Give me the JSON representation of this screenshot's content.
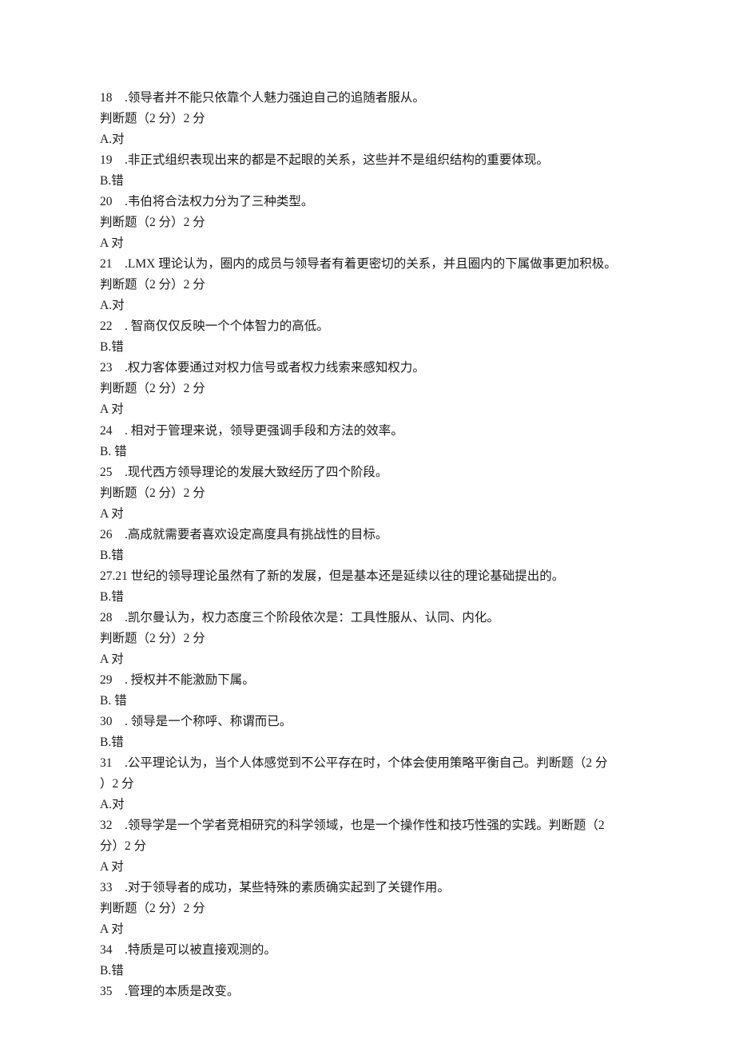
{
  "lines": [
    "18　.领导者并不能只依靠个人魅力强迫自己的追随者服从。",
    "判断题（2 分）2 分",
    "A.对",
    "19　.非正式组织表现出来的都是不起眼的关系，这些并不是组织结构的重要体现。",
    "B.错",
    "20　.韦伯将合法权力分为了三种类型。",
    "判断题（2 分）2 分",
    "A 对",
    "21　.LMX 理论认为，圈内的成员与领导者有着更密切的关系，并且圈内的下属做事更加积极。",
    "判断题（2 分）2 分",
    "A.对",
    "22　. 智商仅仅反映一个个体智力的高低。",
    "B.错",
    "23　.权力客体要通过对权力信号或者权力线索来感知权力。",
    "判断题（2 分）2 分",
    "A 对",
    "24　. 相对于管理来说，领导更强调手段和方法的效率。",
    "B. 错",
    "25　.现代西方领导理论的发展大致经历了四个阶段。",
    "判断题（2 分）2 分",
    "A 对",
    "26　.高成就需要者喜欢设定高度具有挑战性的目标。",
    "B.错",
    "27.21 世纪的领导理论虽然有了新的发展，但是基本还是延续以往的理论基础提出的。",
    "B.错",
    "28　.凯尔曼认为，权力态度三个阶段依次是：工具性服从、认同、内化。",
    "判断题（2 分）2 分",
    "A 对",
    "29　. 授权并不能激励下属。",
    "B. 错",
    "30　. 领导是一个称呼、称谓而已。",
    "B.错",
    "31　.公平理论认为，当个人体感觉到不公平存在时，个体会使用策略平衡自己。判断题（2 分",
    "）2 分",
    "A.对",
    "32　.领导学是一个学者竞相研究的科学领域，也是一个操作性和技巧性强的实践。判断题（2",
    "分）2 分",
    "A 对",
    "33　.对于领导者的成功，某些特殊的素质确实起到了关键作用。",
    "判断题（2 分）2 分",
    "A 对",
    "34　.特质是可以被直接观测的。",
    "B.错",
    "35　.管理的本质是改变。"
  ]
}
